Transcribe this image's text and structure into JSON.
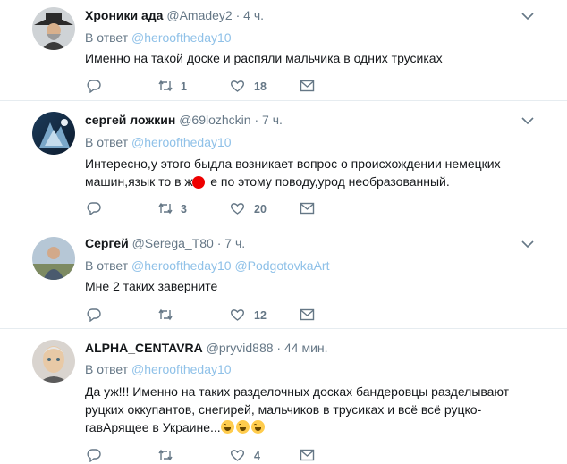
{
  "tweets": [
    {
      "name": "Хроники ада",
      "handle": "@Amadey2",
      "time": "4 ч.",
      "reply_prefix": "В ответ",
      "reply_to": [
        "@herooftheday10"
      ],
      "text_lines": [
        "Именно на такой доске и распяли мальчика в одних трусиках"
      ],
      "retweets": "1",
      "likes": "18"
    },
    {
      "name": "сергей ложкин",
      "handle": "@69lozhckin",
      "time": "7 ч.",
      "reply_prefix": "В ответ",
      "reply_to": [
        "@herooftheday10"
      ],
      "text_lines": [
        "Интересно,у этого быдла возникает вопрос о происхождении немецких",
        "машин,язык то в ж     е по этому поводу,урод необразованный."
      ],
      "retweets": "3",
      "likes": "20"
    },
    {
      "name": "Сергей",
      "handle": "@Serega_T80",
      "time": "7 ч.",
      "reply_prefix": "В ответ",
      "reply_to": [
        "@herooftheday10",
        "@PodgotovkaArt"
      ],
      "text_lines": [
        "Мне 2 таких заверните"
      ],
      "retweets": "",
      "likes": "12"
    },
    {
      "name": "ALPHA_CENTAVRA",
      "handle": "@pryvid888",
      "time": "44 мин.",
      "reply_prefix": "В ответ",
      "reply_to": [
        "@herooftheday10"
      ],
      "text_lines": [
        "Да уж!!! Именно на таких разделочных досках бандеровцы разделывают",
        "руцких оккупантов, снегирей, мальчиков в трусиках и всё всё руцко-",
        "гавАрящее в Украине..."
      ],
      "retweets": "",
      "likes": "4"
    }
  ],
  "separator": "·",
  "icons": {
    "reply": "reply-icon",
    "retweet": "retweet-icon",
    "like": "heart-icon",
    "dm": "envelope-icon",
    "caret": "chevron-down-icon",
    "emoji": "face-with-tears-of-joy-icon"
  },
  "colors": {
    "text": "#14171a",
    "secondary": "#657786",
    "link": "#8fc1e8",
    "divider": "#e6ecf0"
  }
}
